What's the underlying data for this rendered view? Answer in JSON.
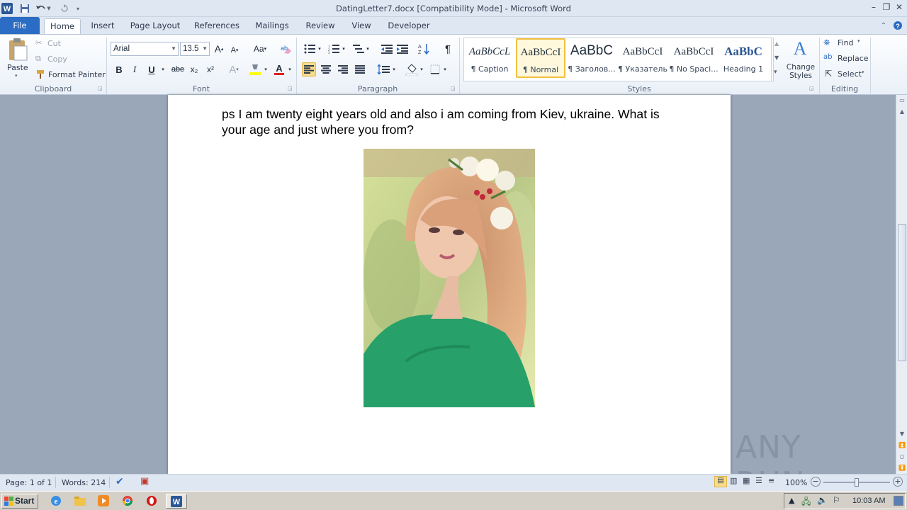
{
  "window": {
    "title": "DatingLetter7.docx [Compatibility Mode] - Microsoft Word"
  },
  "tabs": [
    "File",
    "Home",
    "Insert",
    "Page Layout",
    "References",
    "Mailings",
    "Review",
    "View",
    "Developer"
  ],
  "ribbon": {
    "clipboard": {
      "paste": "Paste",
      "cut": "Cut",
      "copy": "Copy",
      "format_painter": "Format Painter",
      "label": "Clipboard"
    },
    "font": {
      "family": "Arial",
      "size": "13.5",
      "grow": "A",
      "shrink": "A",
      "change_case": "Aa",
      "bold": "B",
      "italic": "I",
      "underline": "U",
      "strikethrough": "abe",
      "subscript": "x₂",
      "superscript": "x²",
      "label": "Font",
      "highlight_color": "#ffff00",
      "font_color": "#e02020"
    },
    "paragraph": {
      "pilcrow": "¶",
      "label": "Paragraph"
    },
    "styles": {
      "items": [
        {
          "sample": "AaBbCcL",
          "name": "¶ Caption"
        },
        {
          "sample": "AaBbCcI",
          "name": "¶ Normal"
        },
        {
          "sample": "AaBbC",
          "name": "¶ Заголов..."
        },
        {
          "sample": "AaBbCcI",
          "name": "¶ Указатель"
        },
        {
          "sample": "AaBbCcI",
          "name": "¶ No Spaci..."
        },
        {
          "sample": "AaBbC",
          "name": "Heading 1"
        }
      ],
      "selected_index": 1,
      "change_styles": "Change Styles",
      "label": "Styles"
    },
    "editing": {
      "find": "Find",
      "replace": "Replace",
      "select": "Select",
      "label": "Editing"
    }
  },
  "document": {
    "line1": "ps I am twenty eight years old and also i am coming from Kiev, ukraine. What is",
    "line2": "your age and just where you from?"
  },
  "status": {
    "page": "Page: 1 of 1",
    "words": "Words: 214",
    "zoom": "100%",
    "zoom_level_percent": 100
  },
  "taskbar": {
    "start": "Start",
    "time": "10:03 AM"
  },
  "watermark": "ANY RUN",
  "colors": {
    "accent": "#2b6cc4",
    "selected_style_border": "#f0c040"
  }
}
